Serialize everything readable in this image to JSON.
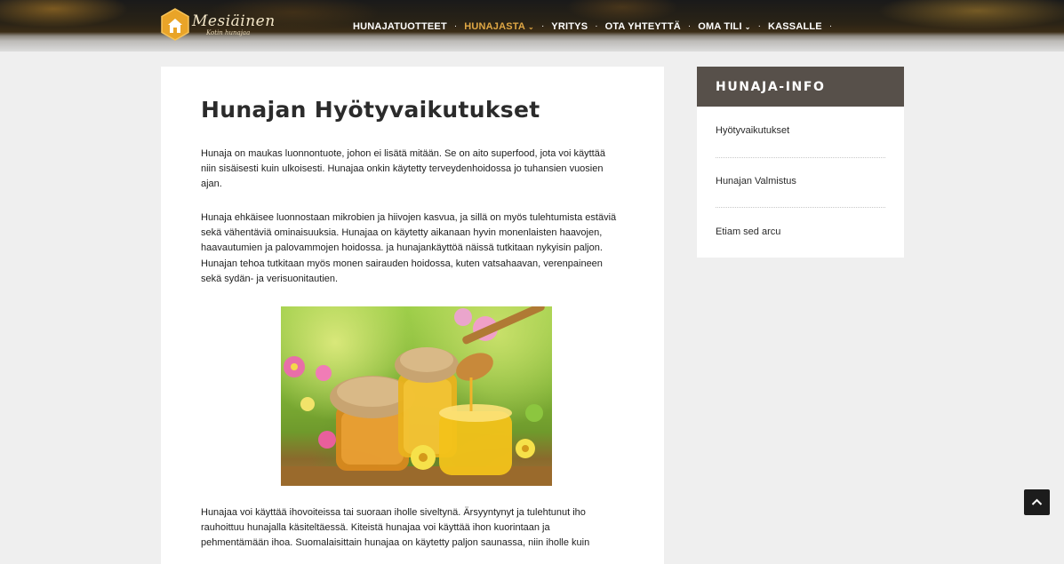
{
  "header": {
    "logo_text": "Mesiäinen",
    "logo_subtext": "Kotin hunajaa",
    "nav": [
      {
        "label": "HUNAJATUOTTEET",
        "active": false,
        "dropdown": false
      },
      {
        "label": "HUNAJASTA",
        "active": true,
        "dropdown": true
      },
      {
        "label": "YRITYS",
        "active": false,
        "dropdown": false
      },
      {
        "label": "OTA YHTEYTTÄ",
        "active": false,
        "dropdown": false
      },
      {
        "label": "OMA TILI",
        "active": false,
        "dropdown": true
      },
      {
        "label": "KASSALLE",
        "active": false,
        "dropdown": false
      }
    ],
    "active_color": "#e0a845"
  },
  "main": {
    "title": "Hunajan Hyötyvaikutukset",
    "paragraph_1": "Hunaja on maukas luonnontuote, johon ei lisätä mitään. Se on aito superfood, jota voi käyttää niin sisäisesti kuin ulkoisesti. Hunajaa onkin käytetty terveydenhoidossa jo tuhansien vuosien ajan.",
    "paragraph_2": "Hunaja ehkäisee luonnostaan mikrobien ja hiivojen kasvua, ja sillä on myös tulehtumista estäviä sekä vähentäviä ominaisuuksia. Hunajaa on käytetty aikanaan hyvin monenlaisten haavojen, haavautumien ja palovammojen hoidossa. ja hunajankäyttöä näissä tutkitaan nykyisin paljon. Hunajan tehoa tutkitaan myös monen sairauden hoidossa, kuten vatsahaavan, verenpaineen sekä sydän- ja verisuonitautien.",
    "paragraph_3": "Hunajaa voi käyttää ihovoiteissa tai suoraan iholle siveltynä. Ärsyyntynyt ja tulehtunut iho rauhoittuu hunajalla käsiteltäessä. Kiteistä hunajaa voi käyttää ihon kuorintaan ja pehmentämään ihoa. Suomalaisittain hunajaa on käytetty paljon saunassa, niin iholle kuin"
  },
  "sidebar": {
    "title": "HUNAJA-INFO",
    "links": [
      "Hyötyvaikutukset",
      "Hunajan Valmistus",
      "Etiam sed arcu"
    ],
    "header_color": "#57504a"
  },
  "icons": {
    "logo": "honey-house-hexagon-icon",
    "back_to_top": "chevron-up-icon",
    "dropdown": "chevron-down-icon"
  }
}
